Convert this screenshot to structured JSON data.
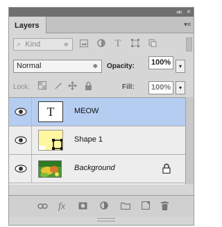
{
  "panel": {
    "tab_label": "Layers",
    "collapse_glyph": "««",
    "close_glyph": "×",
    "menu_glyph": "▾≡"
  },
  "filter": {
    "kind_label": "Kind",
    "search_glyph": "⌕",
    "select_glyph": "≑",
    "icons": [
      "image-filter-icon",
      "adjustment-filter-icon",
      "type-filter-icon",
      "shape-filter-icon",
      "smartobject-filter-icon"
    ]
  },
  "blend": {
    "mode": "Normal",
    "select_glyph": "≑",
    "opacity_label": "Opacity:",
    "opacity_value": "100%",
    "dropdown_glyph": "▾"
  },
  "lock": {
    "label": "Lock:",
    "fill_label": "Fill:",
    "fill_value": "100%",
    "dropdown_glyph": "▾"
  },
  "layers": [
    {
      "name": "MEOW",
      "type": "text",
      "selected": true,
      "visible": true,
      "locked": false,
      "thumb_glyph": "T"
    },
    {
      "name": "Shape 1",
      "type": "shape",
      "selected": false,
      "visible": true,
      "locked": false
    },
    {
      "name": "Background",
      "type": "image",
      "selected": false,
      "visible": true,
      "locked": true,
      "italic": true,
      "lock_glyph": "🔒"
    }
  ],
  "footer": {
    "icons": [
      "link-layers-icon",
      "fx-effects-icon",
      "add-mask-icon",
      "adjustment-layer-icon",
      "new-group-icon",
      "new-layer-icon",
      "delete-layer-icon"
    ],
    "fx_label": "fx"
  },
  "colors": {
    "selected_row": "#b6cdf2",
    "panel_bg": "#d6d6d6",
    "titlebar": "#6f6f6f"
  }
}
